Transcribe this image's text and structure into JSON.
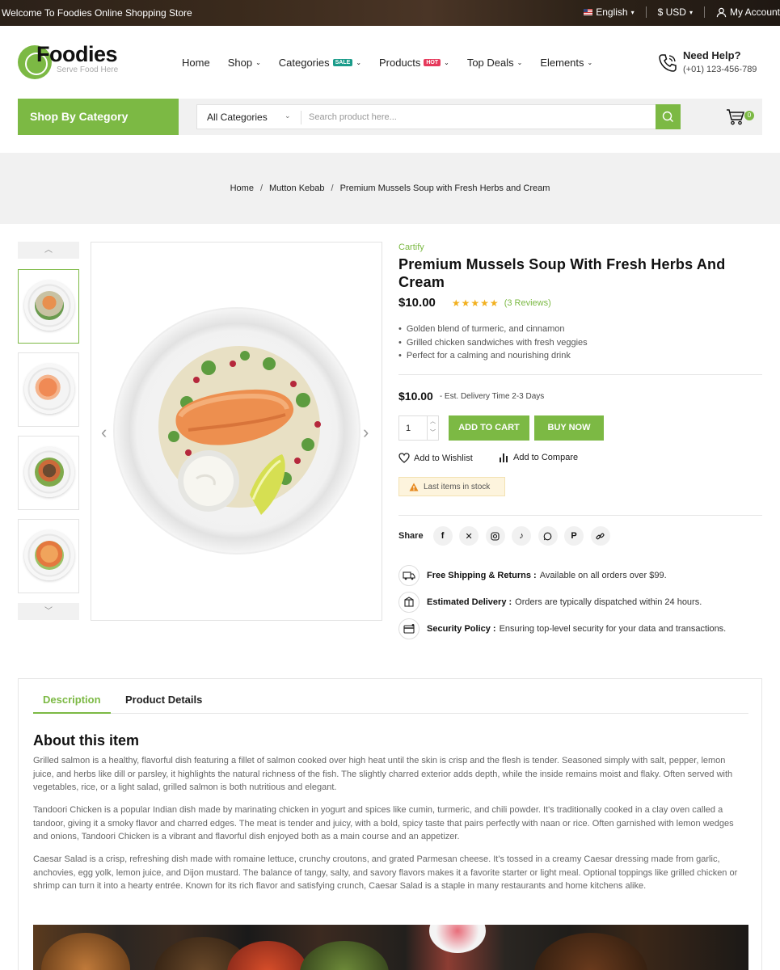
{
  "topbar": {
    "welcome": "Welcome To Foodies Online Shopping Store",
    "language": "English",
    "currency": "$ USD",
    "account": "My Account"
  },
  "header": {
    "logo_name": "Foodies",
    "logo_tagline": "Serve Food Here",
    "nav": [
      {
        "label": "Home"
      },
      {
        "label": "Shop"
      },
      {
        "label": "Categories",
        "badge": "SALE"
      },
      {
        "label": "Products",
        "badge": "HOT"
      },
      {
        "label": "Top Deals"
      },
      {
        "label": "Elements"
      }
    ],
    "help_title": "Need Help?",
    "help_phone": "(+01) 123-456-789"
  },
  "catbar": {
    "shop_by": "Shop By Category",
    "category_select": "All Categories",
    "search_placeholder": "Search product here...",
    "cart_count": "0"
  },
  "breadcrumb": {
    "items": [
      "Home",
      "Mutton Kebab",
      "Premium Mussels Soup with Fresh Herbs and Cream"
    ]
  },
  "product": {
    "brand": "Cartify",
    "title": "Premium Mussels Soup With Fresh Herbs And Cream",
    "price": "$10.00",
    "stars": "★★★★★",
    "rating": 5,
    "reviews": "(3 Reviews)",
    "bullets": [
      "Golden blend of turmeric, and cinnamon",
      "Grilled chicken sandwiches with fresh veggies",
      "Perfect for a calming and nourishing drink"
    ],
    "price2": "$10.00",
    "delivery": "- Est. Delivery Time 2-3 Days",
    "qty": "1",
    "add_to_cart": "ADD TO CART",
    "buy_now": "BUY NOW",
    "wishlist": "Add to Wishlist",
    "compare": "Add to Compare",
    "stock": "Last items in stock",
    "share_label": "Share",
    "features": [
      {
        "title": "Free Shipping & Returns :",
        "text": "Available on all orders over $99."
      },
      {
        "title": "Estimated Delivery :",
        "text": "Orders are typically dispatched within 24 hours."
      },
      {
        "title": "Security Policy :",
        "text": "Ensuring top-level security for your data and transactions."
      }
    ]
  },
  "tabs": {
    "description": "Description",
    "details": "Product Details"
  },
  "about": {
    "heading": "About this item",
    "paragraphs": [
      "Grilled salmon is a healthy, flavorful dish featuring a fillet of salmon cooked over high heat until the skin is crisp and the flesh is tender. Seasoned simply with salt, pepper, lemon juice, and herbs like dill or parsley, it highlights the natural richness of the fish. The slightly charred exterior adds depth, while the inside remains moist and flaky. Often served with vegetables, rice, or a light salad, grilled salmon is both nutritious and elegant.",
      "Tandoori Chicken is a popular Indian dish made by marinating chicken in yogurt and spices like cumin, turmeric, and chili powder. It's traditionally cooked in a clay oven called a tandoor, giving it a smoky flavor and charred edges. The meat is tender and juicy, with a bold, spicy taste that pairs perfectly with naan or rice. Often garnished with lemon wedges and onions, Tandoori Chicken is a vibrant and flavorful dish enjoyed both as a main course and an appetizer.",
      "Caesar Salad is a crisp, refreshing dish made with romaine lettuce, crunchy croutons, and grated Parmesan cheese. It's tossed in a creamy Caesar dressing made from garlic, anchovies, egg yolk, lemon juice, and Dijon mustard. The balance of tangy, salty, and savory flavors makes it a favorite starter or light meal. Optional toppings like grilled chicken or shrimp can turn it into a hearty entrée. Known for its rich flavor and satisfying crunch, Caesar Salad is a staple in many restaurants and home kitchens alike."
    ]
  },
  "colors": {
    "accent": "#7cb944",
    "sale": "#1a9c8a",
    "hot": "#e63a5c",
    "star": "#f2b01e"
  }
}
